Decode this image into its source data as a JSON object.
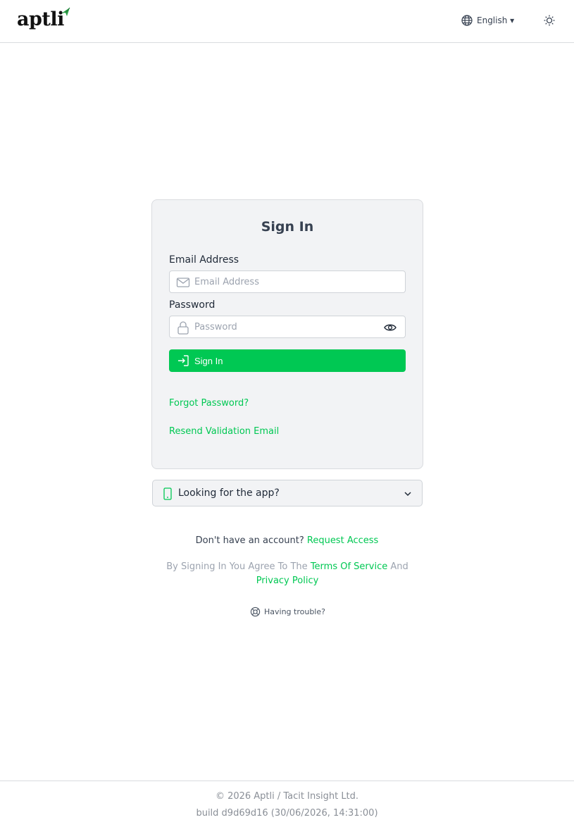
{
  "header": {
    "logo_text": "aptli",
    "language": "English ▾"
  },
  "card": {
    "title": "Sign In",
    "email_label": "Email Address",
    "email_placeholder": "Email Address",
    "email_value": "",
    "password_label": "Password",
    "password_placeholder": "Password",
    "password_value": "",
    "signin_button": "Sign In",
    "forgot_password": "Forgot Password?",
    "resend_validation": "Resend Validation Email"
  },
  "app_prompt": {
    "label": "Looking for the app?"
  },
  "account": {
    "text": "Don't have an account?",
    "link": "Request Access"
  },
  "agreement": {
    "prefix": "By Signing In You Agree To The",
    "terms": "Terms Of Service",
    "and": "And",
    "privacy": "Privacy Policy"
  },
  "trouble": {
    "label": "Having trouble?"
  },
  "footer": {
    "copyright": "© 2026 Aptli / Tacit Insight Ltd.",
    "build": "build d9d69d16 (30/06/2026, 14:31:00)"
  },
  "colors": {
    "accent": "#00c853",
    "card_bg": "#f2f3f5",
    "border": "#d9dbdf",
    "muted_text": "#9ca3af"
  },
  "icons": {
    "language": "globe-icon",
    "theme": "sun-icon",
    "email": "envelope-icon",
    "password": "lock-icon",
    "reveal": "eye-icon",
    "signin": "sign-in-icon",
    "app": "phone-icon",
    "expand": "chevron-down-icon",
    "trouble": "lifebuoy-icon"
  }
}
